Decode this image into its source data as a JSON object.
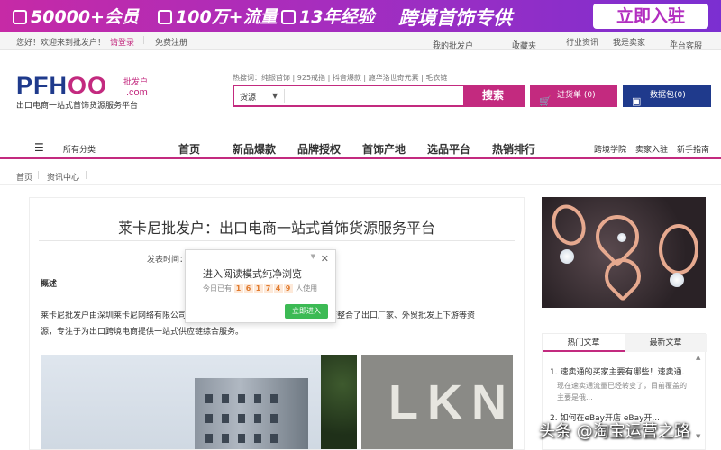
{
  "banner": {
    "item1": "50000+会员",
    "item2": "100万+流量",
    "item3": "13年经验",
    "item4": "跨境首饰专供",
    "cta": "立即入驻"
  },
  "topbar": {
    "welcome": "您好！欢迎来到批发户！",
    "login": "请登录",
    "register": "免费注册",
    "my_account": "我的批发户",
    "favorites": "收藏夹",
    "news": "行业资讯",
    "seller": "我是卖家",
    "service": "平台客服"
  },
  "header": {
    "logo_main_a": "PFH",
    "logo_main_b": "OO",
    "logo_cn": "批发户",
    "logo_com": ".com",
    "slogan": "出口电商一站式首饰货源服务平台",
    "hot_label": "热搜词：",
    "hot_words": "纯银首饰 | 925戒指 | 抖音爆款 | 施华洛世奇元素 | 毛衣链",
    "search_category": "货源",
    "search_button": "搜索",
    "cart_button": "进货单 (0)",
    "data_button": "数据包(0)"
  },
  "nav": {
    "all_categories": "所有分类",
    "items": [
      "首页",
      "新品爆款",
      "品牌授权",
      "首饰产地",
      "选品平台",
      "热销排行"
    ],
    "right": [
      "跨境学院",
      "卖家入驻",
      "新手指南"
    ]
  },
  "breadcrumb": [
    "首页",
    "资讯中心"
  ],
  "article": {
    "title": "莱卡尼批发户：出口电商一站式首饰货源服务平台",
    "publish_label": "发表时间：",
    "overview": "概述",
    "para_line1_a": "莱卡尼批发户由深圳莱卡尼网络有限公司",
    "para_line1_b": "，集结整合了出口厂家、外贸批发上下游等资",
    "para_line2": "源，专注于为出口跨境电商提供一站式供应链综合服务。"
  },
  "popup": {
    "title": "进入阅读模式纯净浏览",
    "prefix": "今日已有",
    "digits": [
      "1",
      "6",
      "1",
      "7",
      "4",
      "9"
    ],
    "suffix": "人使用",
    "button": "立即进入"
  },
  "sidebar": {
    "tab_hot": "热门文章",
    "tab_latest": "最新文章",
    "article1_title": "1. 速卖通的买家主要有哪些！速卖通...",
    "article1_desc": "现在速卖通流量已经转变了，目前覆盖的主要是俄...",
    "article2_title": "2. 如何在eBay开店 eBay开..."
  },
  "watermark": "头条 @淘宝运营之路"
}
